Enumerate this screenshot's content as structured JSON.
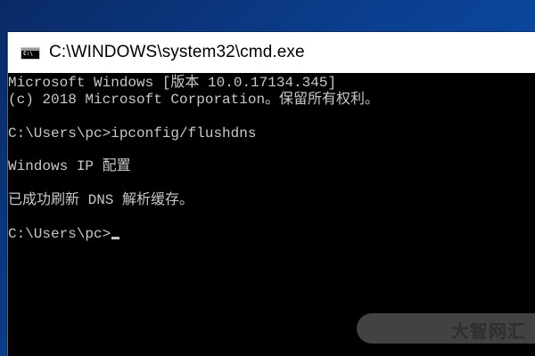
{
  "window": {
    "title": "C:\\WINDOWS\\system32\\cmd.exe",
    "icon": "cmd-console-icon",
    "icon_label": "C:\\"
  },
  "console": {
    "lines": [
      "Microsoft Windows [版本 10.0.17134.345]",
      "(c) 2018 Microsoft Corporation。保留所有权利。",
      "",
      "C:\\Users\\pc>ipconfig/flushdns",
      "",
      "Windows IP 配置",
      "",
      "已成功刷新 DNS 解析缓存。",
      "",
      "C:\\Users\\pc>"
    ]
  },
  "watermark": {
    "text": "大智网汇"
  },
  "colors": {
    "console_background": "#000000",
    "console_text": "#c8c8c8",
    "titlebar_background": "#ffffff",
    "desktop_background": "#0b3f8f"
  }
}
